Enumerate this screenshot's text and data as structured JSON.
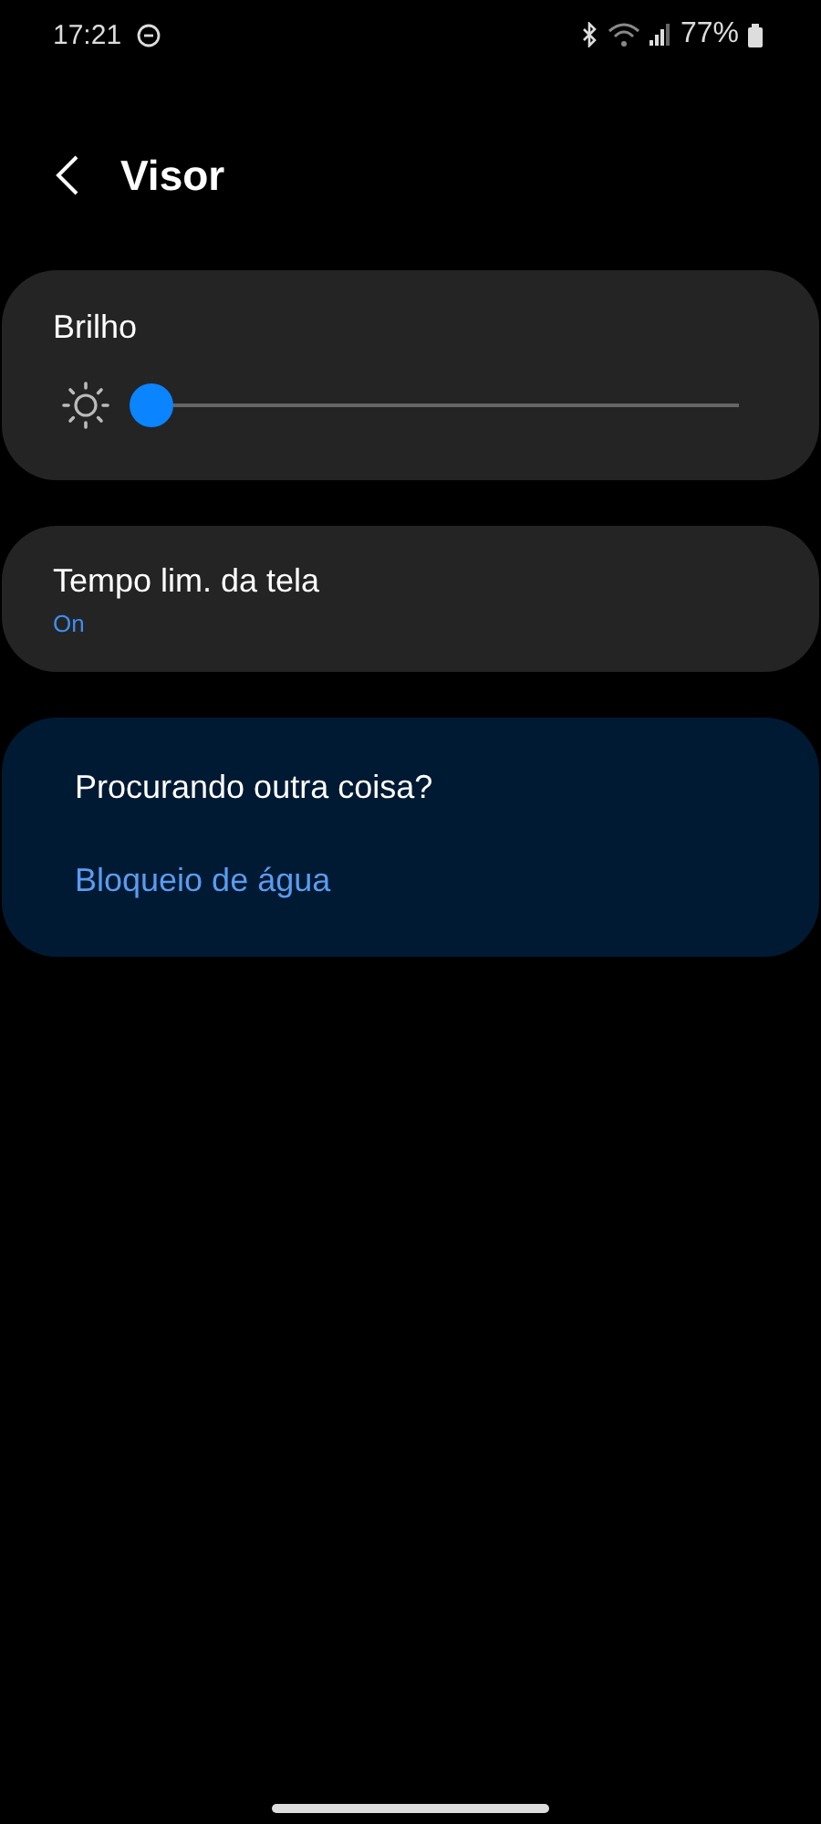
{
  "status_bar": {
    "time": "17:21",
    "battery": "77%"
  },
  "header": {
    "title": "Visor"
  },
  "brightness": {
    "label": "Brilho",
    "level": 0
  },
  "settings": [
    {
      "title": "Tempo lim. da tela",
      "value": "On"
    }
  ],
  "suggestions": {
    "title": "Procurando outra coisa?",
    "links": [
      "Bloqueio de água"
    ]
  }
}
